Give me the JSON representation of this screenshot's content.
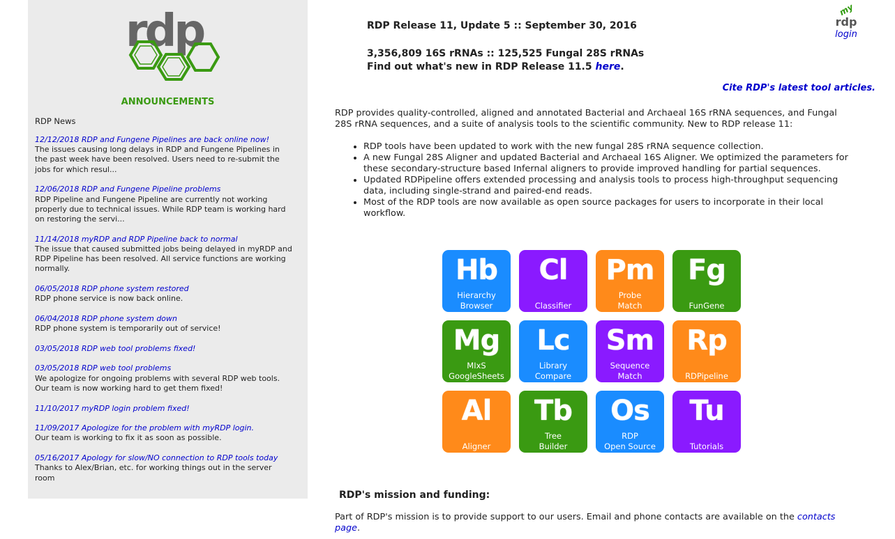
{
  "sidebar": {
    "logo_text": "rdp",
    "announcements_title": "ANNOUNCEMENTS",
    "news_heading": "RDP News",
    "news": [
      {
        "link": "12/12/2018  RDP and Fungene Pipelines are back online now!",
        "body": "The issues causing long delays in RDP and Fungene Pipelines in the past week have been resolved. Users need to re-submit the jobs for which resul..."
      },
      {
        "link": "12/06/2018  RDP and Fungene Pipeline problems",
        "body": "RDP Pipeline and Fungene Pipeline are currently not working properly due to technical issues. While RDP team is working hard on restoring the servi..."
      },
      {
        "link": "11/14/2018  myRDP and RDP Pipeline back to normal",
        "body": "The issue that caused submitted jobs being delayed in myRDP and RDP Pipeline has been resolved. All service functions are working normally."
      },
      {
        "link": "06/05/2018  RDP phone system restored",
        "body": "RDP phone service is now back online."
      },
      {
        "link": "06/04/2018  RDP phone system down",
        "body": "RDP phone system is temporarily out of service!"
      },
      {
        "link": "03/05/2018  RDP web tool problems fixed!",
        "body": ""
      },
      {
        "link": "03/05/2018  RDP web tool problems",
        "body": "We apologize for ongoing problems with several RDP web tools. Our team is now working hard to get them fixed!"
      },
      {
        "link": "11/10/2017  myRDP login problem fixed!",
        "body": ""
      },
      {
        "link": "11/09/2017  Apologize for the problem with myRDP login.",
        "body": "Our team is working to fix it as soon as possible."
      },
      {
        "link": "05/16/2017  Apology for slow/NO connection to RDP tools today",
        "body": "Thanks to Alex/Brian, etc. for working things out in the server room"
      }
    ]
  },
  "main": {
    "release": "RDP Release 11, Update 5 :: September 30, 2016",
    "counts": "3,356,809 16S rRNAs :: 125,525 Fungal 28S rRNAs",
    "whats_new_prefix": "Find out what's new in RDP Release 11.5 ",
    "whats_new_link": "here",
    "whats_new_suffix": ".",
    "cite": "Cite RDP's latest tool articles.",
    "intro": "RDP provides quality-controlled, aligned and annotated Bacterial and Archaeal 16S rRNA sequences, and Fungal 28S rRNA sequences, and a suite of analysis tools to the scientific community. New to RDP release 11:",
    "bullets": [
      "RDP tools have been updated to work with the new fungal 28S rRNA sequence collection.",
      "A new Fungal 28S Aligner and updated Bacterial and Archaeal 16S Aligner. We optimized the parameters for these secondary-structure based Infernal aligners to provide improved handling for partial sequences.",
      "Updated RDPipeline offers extended processing and analysis tools to process high-throughput sequencing data, including single-strand and paired-end reads.",
      "Most of the RDP tools are now available as open source packages for users to incorporate in their local workflow."
    ],
    "mission_heading": "RDP's mission and funding:",
    "mission_text": "Part of RDP's mission is to provide support to our users. Email and phone contacts are available on the ",
    "mission_link": "contacts page",
    "mission_suffix": "."
  },
  "tiles": [
    {
      "abbr": "Hb",
      "label": "Hierarchy\nBrowser",
      "color": "#1a8cff"
    },
    {
      "abbr": "Cl",
      "label": "Classifier",
      "color": "#8a1aff"
    },
    {
      "abbr": "Pm",
      "label": "Probe\nMatch",
      "color": "#ff8a1a"
    },
    {
      "abbr": "Fg",
      "label": "FunGene",
      "color": "#3a9a12"
    },
    {
      "abbr": "Mg",
      "label": "MIxS\nGoogleSheets",
      "color": "#3a9a12"
    },
    {
      "abbr": "Lc",
      "label": "Library\nCompare",
      "color": "#1a8cff"
    },
    {
      "abbr": "Sm",
      "label": "Sequence\nMatch",
      "color": "#8a1aff"
    },
    {
      "abbr": "Rp",
      "label": "RDPipeline",
      "color": "#ff8a1a"
    },
    {
      "abbr": "Al",
      "label": "Aligner",
      "color": "#ff8a1a"
    },
    {
      "abbr": "Tb",
      "label": "Tree\nBuilder",
      "color": "#3a9a12"
    },
    {
      "abbr": "Os",
      "label": "RDP\nOpen Source",
      "color": "#1a8cff"
    },
    {
      "abbr": "Tu",
      "label": "Tutorials",
      "color": "#8a1aff"
    }
  ],
  "myrdp": {
    "my": "my",
    "rdp": "rdp",
    "login": "login"
  }
}
